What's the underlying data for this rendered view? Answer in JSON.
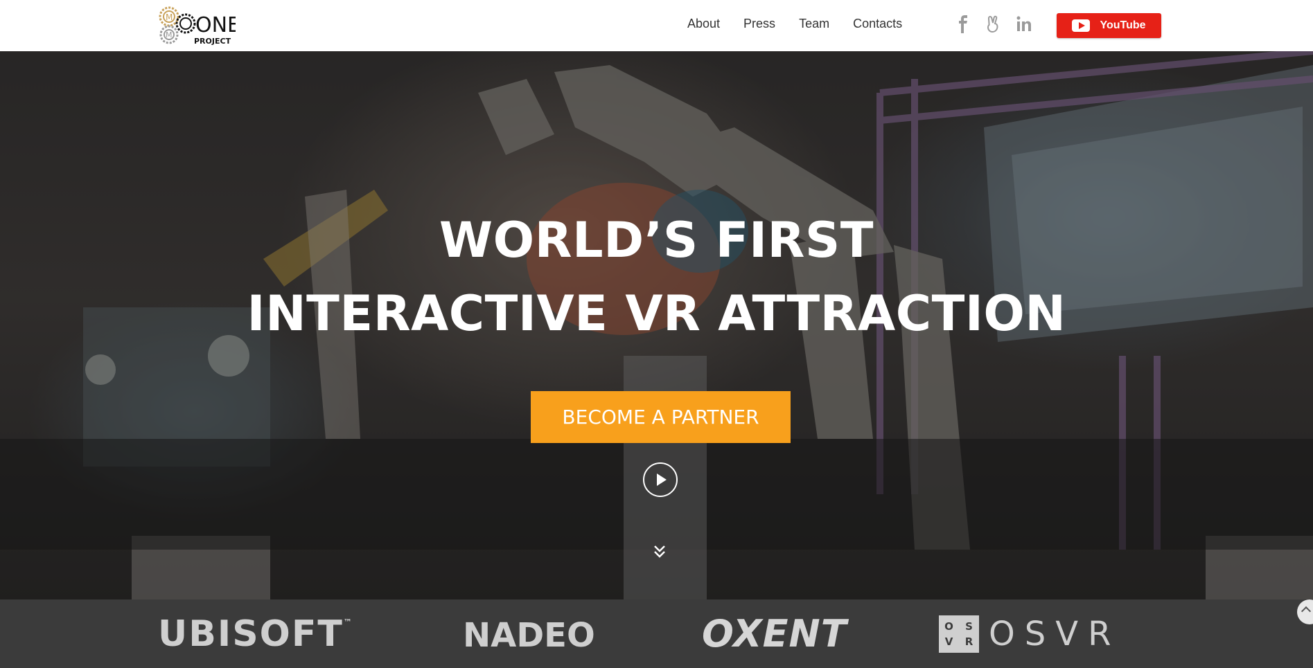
{
  "header": {
    "logo": {
      "wordmark": "ONE",
      "subtext": "PROJECT"
    },
    "nav": [
      {
        "label": "About"
      },
      {
        "label": "Press"
      },
      {
        "label": "Team"
      },
      {
        "label": "Contacts"
      }
    ],
    "social": [
      "facebook-icon",
      "victory-hand-icon",
      "linkedin-icon"
    ],
    "youtube_label": "YouTube"
  },
  "hero": {
    "headline_1": "WORLD’S FIRST",
    "headline_2": "INTERACTIVE VR ATTRACTION",
    "cta_label": "BECOME A PARTNER"
  },
  "partners": [
    {
      "name": "UBISOFT",
      "tm": "™"
    },
    {
      "name": "NADEO"
    },
    {
      "name": "OXENT"
    },
    {
      "name": "OSVR",
      "box": [
        "O",
        "S",
        "V",
        "R"
      ]
    }
  ],
  "colors": {
    "accent": "#f8a01c",
    "youtube": "#e62117",
    "partners_bg": "#3b3b3b"
  }
}
